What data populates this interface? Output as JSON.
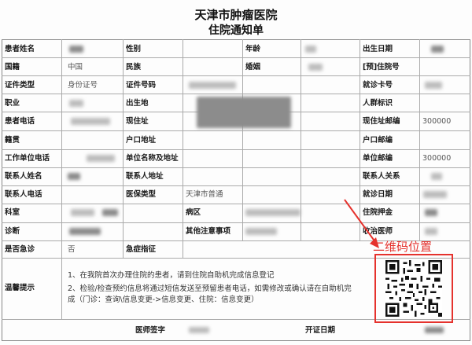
{
  "header": {
    "hospital": "天津市肿瘤医院",
    "doc_title": "住院通知单"
  },
  "fields": {
    "name_label": "患者姓名",
    "gender_label": "性别",
    "age_label": "年龄",
    "birth_label": "出生日期",
    "nation_label": "国籍",
    "nation_value": "中国",
    "ethnic_label": "民族",
    "marriage_label": "婚姻",
    "pre_admit_label": "[预]住院号",
    "id_type_label": "证件类型",
    "id_type_value": "身份证号",
    "id_no_label": "证件号码",
    "visit_card_label": "就诊卡号",
    "job_label": "职业",
    "birthplace_label": "出生地",
    "crowd_label": "人群标识",
    "phone_label": "患者电话",
    "address_label": "现住址",
    "address_zip_label": "现住址邮编",
    "address_zip_value": "300000",
    "native_label": "籍贯",
    "hukou_label": "户口地址",
    "hukou_zip_label": "户口邮编",
    "work_phone_label": "工作单位电话",
    "work_name_label": "单位名称及地址",
    "work_zip_label": "单位邮编",
    "work_zip_value": "300000",
    "contact_name_label": "联系人姓名",
    "contact_addr_label": "联系人地址",
    "contact_rel_label": "联系人关系",
    "contact_phone_label": "联系人电话",
    "insurance_label": "医保类型",
    "insurance_value": "天津市普通",
    "visit_date_label": "就诊日期",
    "dept_label": "科室",
    "ward_label": "病区",
    "deposit_label": "住院押金",
    "diag_label": "诊断",
    "notes_label": "其他注意事项",
    "doctor_label": "收治医师",
    "urgent_label": "是否急诊",
    "urgent_value": "否",
    "urgent_ind_label": "急症指征"
  },
  "tips": {
    "label": "温馨提示",
    "line1": "1、在我院首次办理住院的患者，请到住院自助机完成信息登记",
    "line2": "2、检验/检查预约信息将通过短信发送至预留患者电话，如需修改或确认请在自助机完成（门诊：查询\\信息变更->信息变更、住院：信息变更）"
  },
  "footer": {
    "signature_label": "医师签字",
    "issue_date_label": "开证日期"
  },
  "annotation": {
    "qr_position": "二维码位置",
    "color": "#e5322d"
  }
}
